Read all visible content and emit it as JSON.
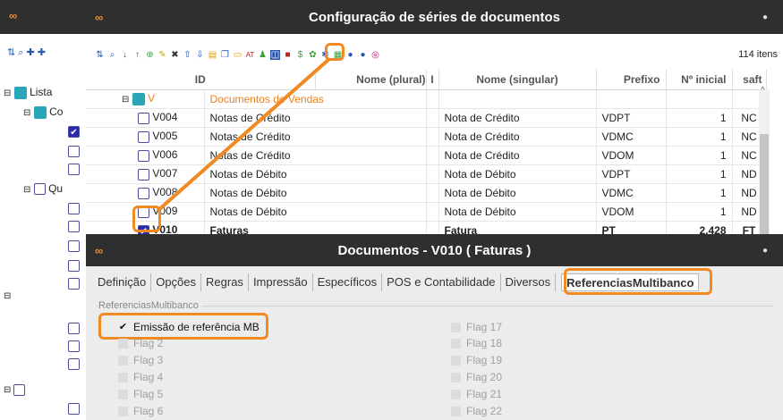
{
  "back_window": {
    "tree_items": [
      "Lista",
      "Co",
      "Qu"
    ]
  },
  "series_window": {
    "title": "Configuração de séries de documentos",
    "item_count": "114 itens",
    "columns": {
      "id": "ID",
      "name_plural": "Nome (plural)",
      "sep": "I",
      "name_singular": "Nome (singular)",
      "prefix": "Prefixo",
      "initial": "Nº inicial",
      "saft": "saft"
    },
    "group_row": {
      "id": "V",
      "name": "Documentos de Vendas"
    },
    "rows": [
      {
        "id": "V004",
        "plural": "Notas de Crédito",
        "singular": "Nota de Crédito",
        "prefix": "VDPT",
        "initial": "1",
        "saft": "NC",
        "checked": false
      },
      {
        "id": "V005",
        "plural": "Notas de Crédito",
        "singular": "Nota de Crédito",
        "prefix": "VDMC",
        "initial": "1",
        "saft": "NC",
        "checked": false
      },
      {
        "id": "V006",
        "plural": "Notas de Crédito",
        "singular": "Nota de Crédito",
        "prefix": "VDOM",
        "initial": "1",
        "saft": "NC",
        "checked": false
      },
      {
        "id": "V007",
        "plural": "Notas de Débito",
        "singular": "Nota de Débito",
        "prefix": "VDPT",
        "initial": "1",
        "saft": "ND",
        "checked": false
      },
      {
        "id": "V008",
        "plural": "Notas de Débito",
        "singular": "Nota de Débito",
        "prefix": "VDMC",
        "initial": "1",
        "saft": "ND",
        "checked": false
      },
      {
        "id": "V009",
        "plural": "Notas de Débito",
        "singular": "Nota de Débito",
        "prefix": "VDOM",
        "initial": "1",
        "saft": "ND",
        "checked": false
      },
      {
        "id": "V010",
        "plural": "Faturas",
        "singular": "Fatura",
        "prefix": "PT",
        "initial": "2,428",
        "saft": "FT",
        "checked": true
      }
    ]
  },
  "docs_window": {
    "title": "Documentos - V010 ( Faturas )",
    "tabs": [
      "Definição",
      "Opções",
      "Regras",
      "Impressão",
      "Específicos",
      "POS e Contabilidade",
      "Diversos",
      "ReferenciasMultibanco"
    ],
    "active_tab": "ReferenciasMultibanco",
    "group_title": "ReferenciasMultibanco",
    "flags_left": [
      "Emissão de referência MB",
      "Flag 2",
      "Flag 3",
      "Flag 4",
      "Flag 5",
      "Flag 6"
    ],
    "flags_right": [
      "Flag 17",
      "Flag 18",
      "Flag 19",
      "Flag 20",
      "Flag 21",
      "Flag 22"
    ],
    "checked_flag": "Emissão de referência MB"
  },
  "colors": {
    "accent": "#f08a24",
    "titlebar": "#2f2f2f",
    "group_text": "#e8801e"
  }
}
